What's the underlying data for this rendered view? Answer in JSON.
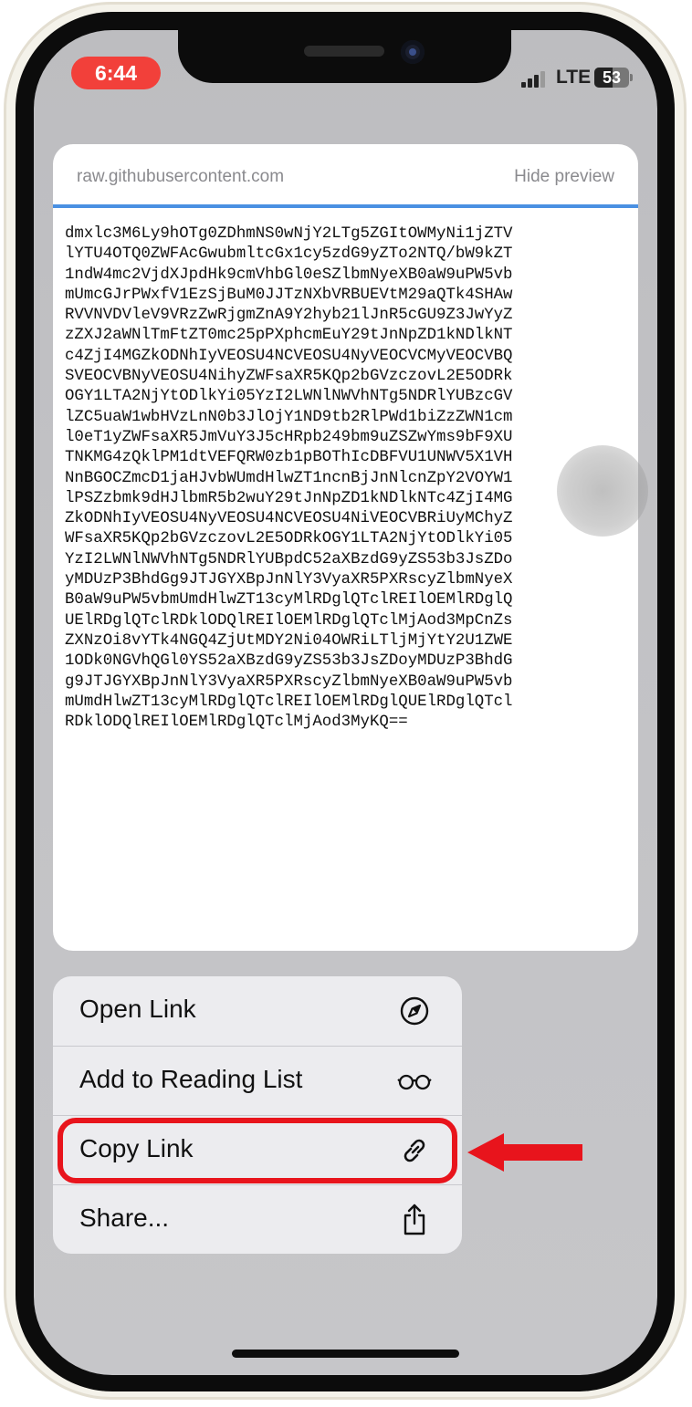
{
  "status_bar": {
    "time": "6:44",
    "network": "LTE",
    "battery_level": "53",
    "signal_bars": 3,
    "time_pill_color": "#f2403a"
  },
  "preview": {
    "url": "raw.githubusercontent.com",
    "hide_label": "Hide preview",
    "load_progress": 1.0,
    "content_lines": [
      "dmxlc3M6Ly9hOTg0ZDhmNS0wNjY2LTg5ZGItOWMyNi1jZTV",
      "lYTU4OTQ0ZWFAcGwubmltcGx1cy5zdG9yZTo2NTQ/bW9kZT",
      "1ndW4mc2VjdXJpdHk9cmVhbGl0eSZlbmNyeXB0aW9uPW5vb",
      "mUmcGJrPWxfV1EzSjBuM0JJTzNXbVRBUEVtM29aQTk4SHAw",
      "RVVNVDVleV9VRzZwRjgmZnA9Y2hyb21lJnR5cGU9Z3JwYyZ",
      "zZXJ2aWNlTmFtZT0mc25pPXphcmEuY29tJnNpZD1kNDlkNT",
      "c4ZjI4MGZkODNhIyVEOSU4NCVEOSU4NyVEOCVCMyVEOCVBQ",
      "SVEOCVBNyVEOSU4NihyZWFsaXR5KQp2bGVzczovL2E5ODRk",
      "OGY1LTA2NjYtODlkYi05YzI2LWNlNWVhNTg5NDRlYUBzcGV",
      "lZC5uaW1wbHVzLnN0b3JlOjY1ND9tb2RlPWd1biZzZWN1cm",
      "l0eT1yZWFsaXR5JmVuY3J5cHRpb249bm9uZSZwYms9bF9XU",
      "TNKMG4zQklPM1dtVEFQRW0zb1pBOThIcDBFVU1UNWV5X1VH",
      "NnBGOCZmcD1jaHJvbWUmdHlwZT1ncnBjJnNlcnZpY2VOYW1",
      "lPSZzbmk9dHJlbmR5b2wuY29tJnNpZD1kNDlkNTc4ZjI4MG",
      "ZkODNhIyVEOSU4NyVEOSU4NCVEOSU4NiVEOCVBRiUyMChyZ",
      "WFsaXR5KQp2bGVzczovL2E5ODRkOGY1LTA2NjYtODlkYi05",
      "YzI2LWNlNWVhNTg5NDRlYUBpdC52aXBzdG9yZS53b3JsZDo",
      "yMDUzP3BhdGg9JTJGYXBpJnNlY3VyaXR5PXRscyZlbmNyeX",
      "B0aW9uPW5vbmUmdHlwZT13cyMlRDglQTclREIlOEMlRDglQ",
      "UElRDglQTclRDklODQlREIlOEMlRDglQTclMjAod3MpCnZs",
      "ZXNzOi8vYTk4NGQ4ZjUtMDY2Ni04OWRiLTljMjYtY2U1ZWE",
      "1ODk0NGVhQGl0YS52aXBzdG9yZS53b3JsZDoyMDUzP3BhdG",
      "g9JTJGYXBpJnNlY3VyaXR5PXRscyZlbmNyeXB0aW9uPW5vb",
      "mUmdHlwZT13cyMlRDglQTclREIlOEMlRDglQUElRDglQTcl",
      "RDklODQlREIlOEMlRDglQTclMjAod3MyKQ=="
    ]
  },
  "context_menu": {
    "items": [
      {
        "label": "Open Link",
        "icon": "compass-icon"
      },
      {
        "label": "Add to Reading List",
        "icon": "glasses-icon"
      },
      {
        "label": "Copy Link",
        "icon": "link-icon"
      },
      {
        "label": "Share...",
        "icon": "share-icon"
      }
    ],
    "highlighted_item": "Copy Link",
    "highlight_color": "#e8141c"
  }
}
